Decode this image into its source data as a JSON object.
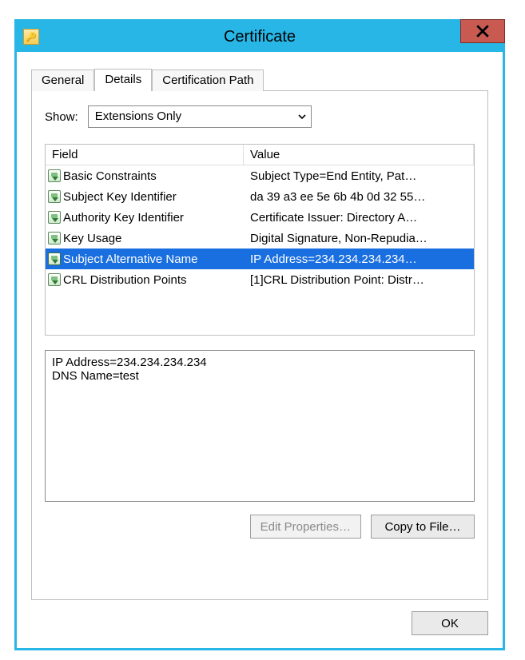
{
  "window": {
    "title": "Certificate"
  },
  "tabs": {
    "general": "General",
    "details": "Details",
    "certpath": "Certification Path"
  },
  "show": {
    "label": "Show:",
    "selected": "Extensions Only"
  },
  "columns": {
    "field": "Field",
    "value": "Value"
  },
  "rows": [
    {
      "field": "Basic Constraints",
      "value": "Subject Type=End Entity, Pat…",
      "selected": false
    },
    {
      "field": "Subject Key Identifier",
      "value": "da 39 a3 ee 5e 6b 4b 0d 32 55…",
      "selected": false
    },
    {
      "field": "Authority Key Identifier",
      "value": "Certificate Issuer: Directory A…",
      "selected": false
    },
    {
      "field": "Key Usage",
      "value": "Digital Signature, Non-Repudia…",
      "selected": false
    },
    {
      "field": "Subject Alternative Name",
      "value": "IP Address=234.234.234.234…",
      "selected": true
    },
    {
      "field": "CRL Distribution Points",
      "value": "[1]CRL Distribution Point: Distr…",
      "selected": false
    }
  ],
  "detail_text": "IP Address=234.234.234.234\nDNS Name=test",
  "buttons": {
    "edit_props": "Edit Properties…",
    "copy_to_file": "Copy to File…",
    "ok": "OK"
  }
}
